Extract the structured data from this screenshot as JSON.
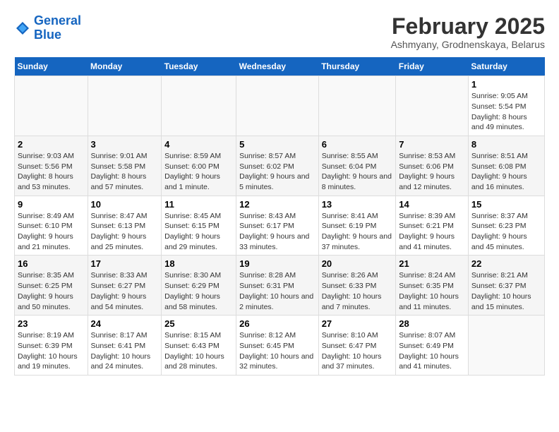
{
  "header": {
    "logo_line1": "General",
    "logo_line2": "Blue",
    "title": "February 2025",
    "subtitle": "Ashmyany, Grodnenskaya, Belarus"
  },
  "weekdays": [
    "Sunday",
    "Monday",
    "Tuesday",
    "Wednesday",
    "Thursday",
    "Friday",
    "Saturday"
  ],
  "weeks": [
    [
      {
        "day": "",
        "info": ""
      },
      {
        "day": "",
        "info": ""
      },
      {
        "day": "",
        "info": ""
      },
      {
        "day": "",
        "info": ""
      },
      {
        "day": "",
        "info": ""
      },
      {
        "day": "",
        "info": ""
      },
      {
        "day": "1",
        "info": "Sunrise: 9:05 AM\nSunset: 5:54 PM\nDaylight: 8 hours and 49 minutes."
      }
    ],
    [
      {
        "day": "2",
        "info": "Sunrise: 9:03 AM\nSunset: 5:56 PM\nDaylight: 8 hours and 53 minutes."
      },
      {
        "day": "3",
        "info": "Sunrise: 9:01 AM\nSunset: 5:58 PM\nDaylight: 8 hours and 57 minutes."
      },
      {
        "day": "4",
        "info": "Sunrise: 8:59 AM\nSunset: 6:00 PM\nDaylight: 9 hours and 1 minute."
      },
      {
        "day": "5",
        "info": "Sunrise: 8:57 AM\nSunset: 6:02 PM\nDaylight: 9 hours and 5 minutes."
      },
      {
        "day": "6",
        "info": "Sunrise: 8:55 AM\nSunset: 6:04 PM\nDaylight: 9 hours and 8 minutes."
      },
      {
        "day": "7",
        "info": "Sunrise: 8:53 AM\nSunset: 6:06 PM\nDaylight: 9 hours and 12 minutes."
      },
      {
        "day": "8",
        "info": "Sunrise: 8:51 AM\nSunset: 6:08 PM\nDaylight: 9 hours and 16 minutes."
      }
    ],
    [
      {
        "day": "9",
        "info": "Sunrise: 8:49 AM\nSunset: 6:10 PM\nDaylight: 9 hours and 21 minutes."
      },
      {
        "day": "10",
        "info": "Sunrise: 8:47 AM\nSunset: 6:13 PM\nDaylight: 9 hours and 25 minutes."
      },
      {
        "day": "11",
        "info": "Sunrise: 8:45 AM\nSunset: 6:15 PM\nDaylight: 9 hours and 29 minutes."
      },
      {
        "day": "12",
        "info": "Sunrise: 8:43 AM\nSunset: 6:17 PM\nDaylight: 9 hours and 33 minutes."
      },
      {
        "day": "13",
        "info": "Sunrise: 8:41 AM\nSunset: 6:19 PM\nDaylight: 9 hours and 37 minutes."
      },
      {
        "day": "14",
        "info": "Sunrise: 8:39 AM\nSunset: 6:21 PM\nDaylight: 9 hours and 41 minutes."
      },
      {
        "day": "15",
        "info": "Sunrise: 8:37 AM\nSunset: 6:23 PM\nDaylight: 9 hours and 45 minutes."
      }
    ],
    [
      {
        "day": "16",
        "info": "Sunrise: 8:35 AM\nSunset: 6:25 PM\nDaylight: 9 hours and 50 minutes."
      },
      {
        "day": "17",
        "info": "Sunrise: 8:33 AM\nSunset: 6:27 PM\nDaylight: 9 hours and 54 minutes."
      },
      {
        "day": "18",
        "info": "Sunrise: 8:30 AM\nSunset: 6:29 PM\nDaylight: 9 hours and 58 minutes."
      },
      {
        "day": "19",
        "info": "Sunrise: 8:28 AM\nSunset: 6:31 PM\nDaylight: 10 hours and 2 minutes."
      },
      {
        "day": "20",
        "info": "Sunrise: 8:26 AM\nSunset: 6:33 PM\nDaylight: 10 hours and 7 minutes."
      },
      {
        "day": "21",
        "info": "Sunrise: 8:24 AM\nSunset: 6:35 PM\nDaylight: 10 hours and 11 minutes."
      },
      {
        "day": "22",
        "info": "Sunrise: 8:21 AM\nSunset: 6:37 PM\nDaylight: 10 hours and 15 minutes."
      }
    ],
    [
      {
        "day": "23",
        "info": "Sunrise: 8:19 AM\nSunset: 6:39 PM\nDaylight: 10 hours and 19 minutes."
      },
      {
        "day": "24",
        "info": "Sunrise: 8:17 AM\nSunset: 6:41 PM\nDaylight: 10 hours and 24 minutes."
      },
      {
        "day": "25",
        "info": "Sunrise: 8:15 AM\nSunset: 6:43 PM\nDaylight: 10 hours and 28 minutes."
      },
      {
        "day": "26",
        "info": "Sunrise: 8:12 AM\nSunset: 6:45 PM\nDaylight: 10 hours and 32 minutes."
      },
      {
        "day": "27",
        "info": "Sunrise: 8:10 AM\nSunset: 6:47 PM\nDaylight: 10 hours and 37 minutes."
      },
      {
        "day": "28",
        "info": "Sunrise: 8:07 AM\nSunset: 6:49 PM\nDaylight: 10 hours and 41 minutes."
      },
      {
        "day": "",
        "info": ""
      }
    ]
  ]
}
